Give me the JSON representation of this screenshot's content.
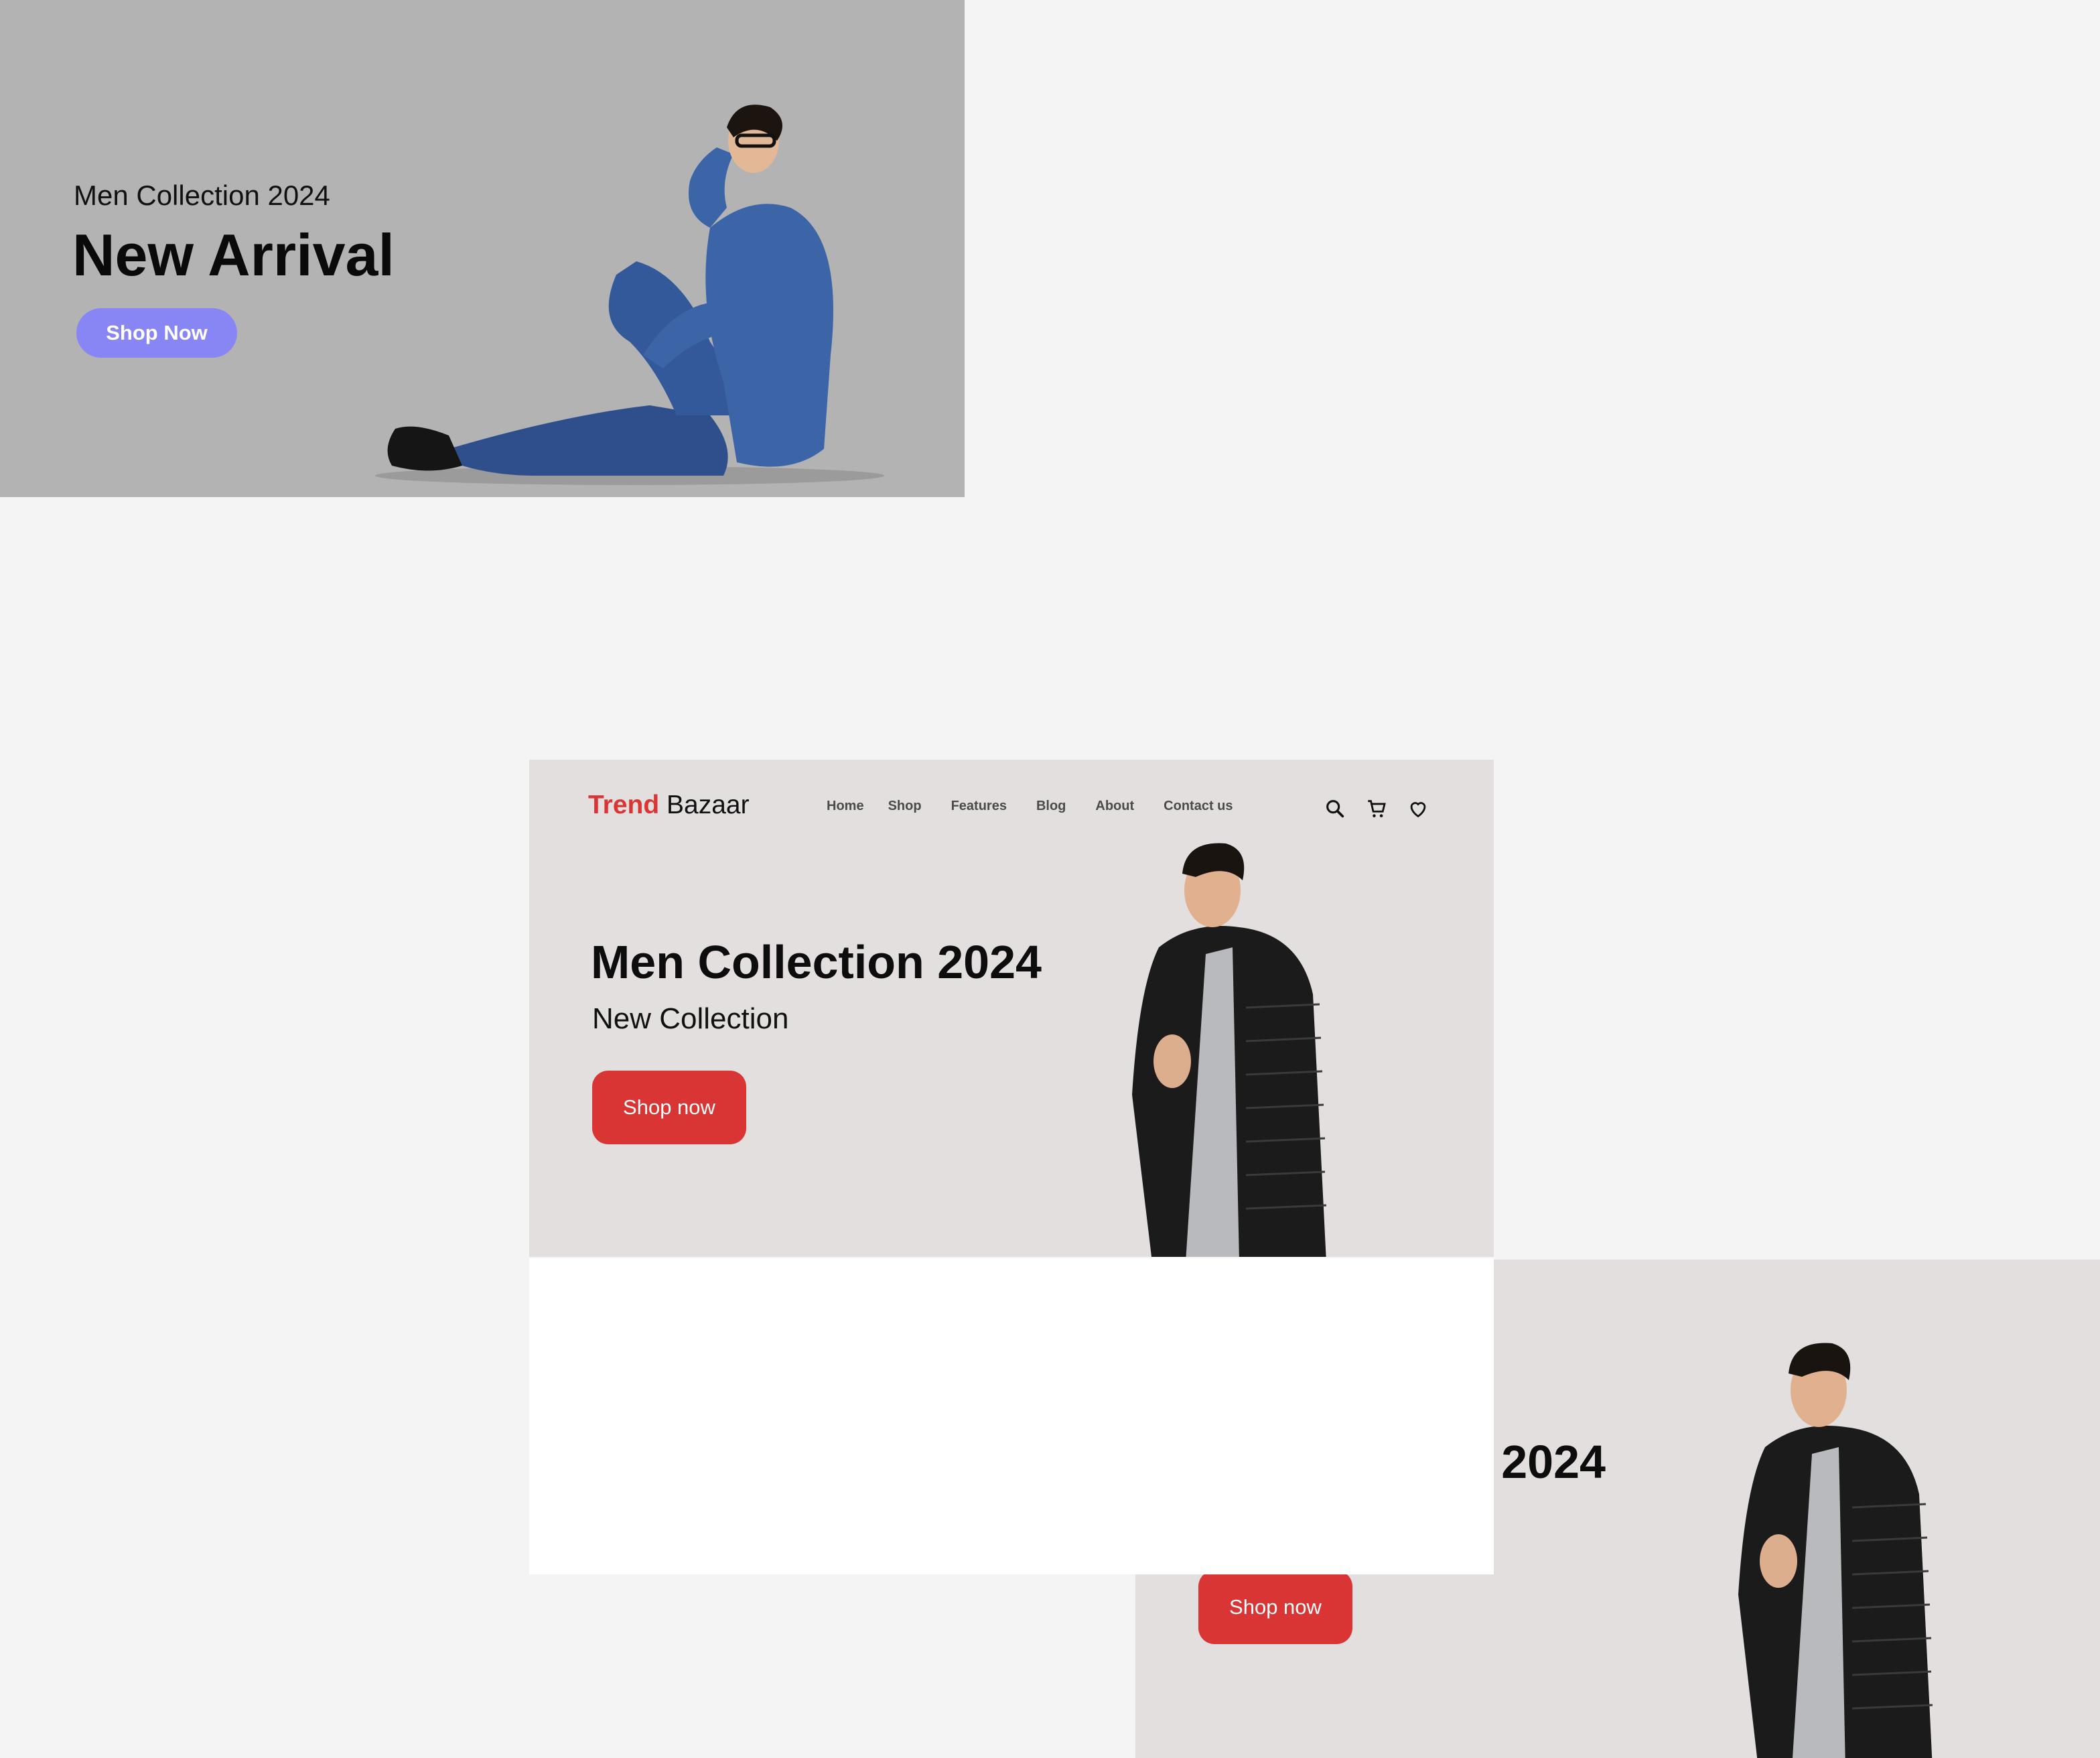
{
  "panel_a": {
    "subtitle": "Men Collection 2024",
    "title": "New Arrival",
    "button_label": "Shop Now",
    "button_color": "#8886f4",
    "background": "#b3b3b3",
    "image": "man-sitting-denim"
  },
  "panel_b": {
    "logo": {
      "brand_primary": "Trend",
      "brand_secondary": "Bazaar",
      "accent": "#d93535"
    },
    "nav": {
      "items": [
        {
          "label": "Home"
        },
        {
          "label": "Shop"
        },
        {
          "label": "Features"
        },
        {
          "label": "Blog"
        },
        {
          "label": "About"
        },
        {
          "label": "Contact us"
        }
      ]
    },
    "icons": [
      "search-icon",
      "cart-icon",
      "heart-icon"
    ],
    "hero": {
      "title": "Men Collection 2024",
      "subtitle": "New Collection",
      "button_label": "Shop now",
      "button_color": "#d93535"
    },
    "background": "#e2dfde",
    "image": "man-black-jacket"
  },
  "panel_c": {
    "title": "n 2024",
    "button_label": "Shop now",
    "image": "man-black-jacket"
  }
}
